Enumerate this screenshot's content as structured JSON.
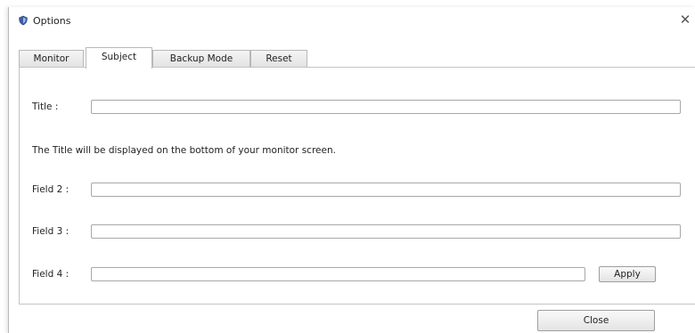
{
  "window": {
    "title": "Options",
    "close_glyph": "✕",
    "icon": "app-shield-icon"
  },
  "tabs": [
    {
      "label": "Monitor",
      "active": false
    },
    {
      "label": "Subject",
      "active": true
    },
    {
      "label": "Backup Mode",
      "active": false
    },
    {
      "label": "Reset",
      "active": false
    }
  ],
  "form": {
    "title_label": "Title :",
    "title_value": "",
    "info_text": "The Title will be displayed on the bottom of your monitor screen.",
    "field2_label": "Field 2 :",
    "field2_value": "",
    "field3_label": "Field 3 :",
    "field3_value": "",
    "field4_label": "Field 4 :",
    "field4_value": "",
    "apply_label": "Apply"
  },
  "footer": {
    "close_label": "Close"
  }
}
